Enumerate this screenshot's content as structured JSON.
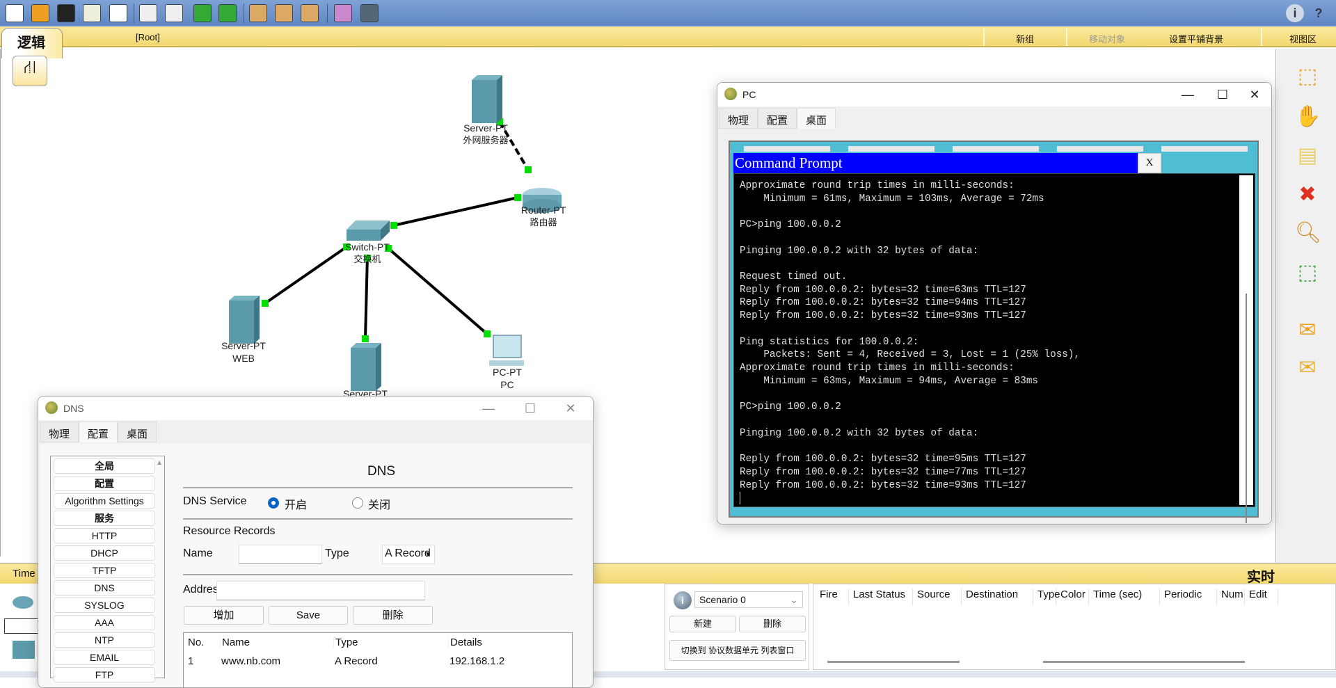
{
  "toolbar": {
    "icons": [
      "new-file-icon",
      "open-folder-icon",
      "save-icon",
      "print-icon",
      "edit-icon",
      "copy-icon",
      "paste-icon",
      "undo-icon",
      "redo-icon",
      "zoom-in-icon",
      "zoom-reset-icon",
      "zoom-out-icon",
      "palette-icon",
      "custom-device-icon"
    ],
    "right_icons": [
      "info-icon",
      "help-icon"
    ]
  },
  "workspace_bar": {
    "tab_label": "逻辑",
    "path": "[Root]",
    "new_cluster": "新组",
    "move_object": "移动对象",
    "set_tiled_background": "设置平铺背景",
    "viewport": "视图区"
  },
  "topology": {
    "nodes": [
      {
        "id": "ext-server",
        "model": "Server-PT",
        "name": "外网服务器"
      },
      {
        "id": "router",
        "model": "Router-PT",
        "name": "路由器"
      },
      {
        "id": "switch",
        "model": "Switch-PT",
        "name": "交换机"
      },
      {
        "id": "web-server",
        "model": "Server-PT",
        "name": "WEB"
      },
      {
        "id": "dns-server",
        "model": "Server-PT",
        "name": ""
      },
      {
        "id": "pc",
        "model": "PC-PT",
        "name": "PC"
      }
    ],
    "link_color": "#000000",
    "port_status_color": "#00e000"
  },
  "right_tools": [
    "select-icon",
    "hand-move-icon",
    "note-icon",
    "delete-icon",
    "inspect-icon",
    "resize-shape-icon",
    "add-simple-pdu-icon",
    "add-complex-pdu-icon"
  ],
  "pc_window": {
    "title": "PC",
    "tabs": [
      "物理",
      "配置",
      "桌面"
    ],
    "active_tab": "桌面",
    "cmd": {
      "title": "Command Prompt",
      "close": "X",
      "lines": [
        "Approximate round trip times in milli-seconds:",
        "    Minimum = 61ms, Maximum = 103ms, Average = 72ms",
        "",
        "PC>ping 100.0.0.2",
        "",
        "Pinging 100.0.0.2 with 32 bytes of data:",
        "",
        "Request timed out.",
        "Reply from 100.0.0.2: bytes=32 time=63ms TTL=127",
        "Reply from 100.0.0.2: bytes=32 time=94ms TTL=127",
        "Reply from 100.0.0.2: bytes=32 time=93ms TTL=127",
        "",
        "Ping statistics for 100.0.0.2:",
        "    Packets: Sent = 4, Received = 3, Lost = 1 (25% loss),",
        "Approximate round trip times in milli-seconds:",
        "    Minimum = 63ms, Maximum = 94ms, Average = 83ms",
        "",
        "PC>ping 100.0.0.2",
        "",
        "Pinging 100.0.0.2 with 32 bytes of data:",
        "",
        "Reply from 100.0.0.2: bytes=32 time=95ms TTL=127",
        "Reply from 100.0.0.2: bytes=32 time=77ms TTL=127",
        "Reply from 100.0.0.2: bytes=32 time=93ms TTL=127"
      ]
    }
  },
  "dns_window": {
    "title": "DNS",
    "tabs": [
      "物理",
      "配置",
      "桌面"
    ],
    "active_tab": "配置",
    "menu": [
      {
        "label": "全局",
        "header": true
      },
      {
        "label": "配置",
        "header": true
      },
      {
        "label": "Algorithm Settings",
        "header": false
      },
      {
        "label": "服务",
        "header": true
      },
      {
        "label": "HTTP",
        "header": false
      },
      {
        "label": "DHCP",
        "header": false
      },
      {
        "label": "TFTP",
        "header": false
      },
      {
        "label": "DNS",
        "header": false
      },
      {
        "label": "SYSLOG",
        "header": false
      },
      {
        "label": "AAA",
        "header": false
      },
      {
        "label": "NTP",
        "header": false
      },
      {
        "label": "EMAIL",
        "header": false
      },
      {
        "label": "FTP",
        "header": false
      }
    ],
    "panel": {
      "heading": "DNS",
      "service_label": "DNS Service",
      "on_label": "开启",
      "off_label": "关闭",
      "service_on": true,
      "resource_records": "Resource Records",
      "name_label": "Name",
      "name_value": "",
      "type_label": "Type",
      "type_value": "A Record",
      "address_label": "Address",
      "address_value": "",
      "add_button": "增加",
      "save_button": "Save",
      "delete_button": "删除",
      "table": {
        "headers": [
          "No.",
          "Name",
          "Type",
          "Details"
        ],
        "rows": [
          [
            "1",
            "www.nb.com",
            "A Record",
            "192.168.1.2"
          ]
        ]
      }
    }
  },
  "bottom": {
    "time_tab": "Time",
    "realtime_label": "实时",
    "scenario": "Scenario 0",
    "new_button": "新建",
    "delete_button": "删除",
    "toggle_pdu_list": "切换到 协议数据单元 列表窗口",
    "columns": [
      "Fire",
      "Last Status",
      "Source",
      "Destination",
      "Type",
      "Color",
      "Time (sec)",
      "Periodic",
      "Num",
      "Edit"
    ]
  }
}
